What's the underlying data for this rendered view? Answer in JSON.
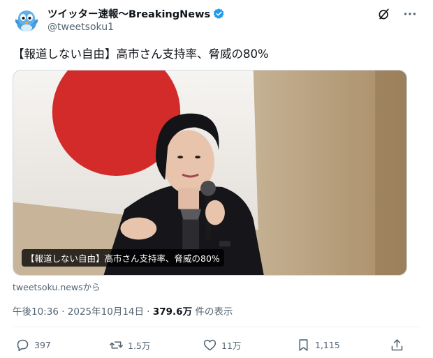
{
  "author": {
    "display_name": "ツイッター速報〜BreakingNews",
    "handle": "@tweetsoku1",
    "verified": true,
    "verified_color": "#1d9bf0",
    "avatar_icon": "bird-mascot-icon"
  },
  "tweet": {
    "text": "【報道しない自由】高市さん支持率、脅威の80%"
  },
  "card": {
    "caption": "【報道しない自由】高市さん支持率、脅威の80%",
    "source": "tweetsoku.newsから"
  },
  "meta": {
    "time": "午後10:36",
    "sep1": " · ",
    "date": "2025年10月14日",
    "sep2": " · ",
    "views_count": "379.6万",
    "views_label": " 件の表示"
  },
  "actions": {
    "replies": "397",
    "retweets": "1.5万",
    "likes": "11万",
    "bookmarks": "1,115"
  },
  "colors": {
    "text": "#0f1419",
    "secondary": "#536471",
    "accent": "#1d9bf0"
  }
}
